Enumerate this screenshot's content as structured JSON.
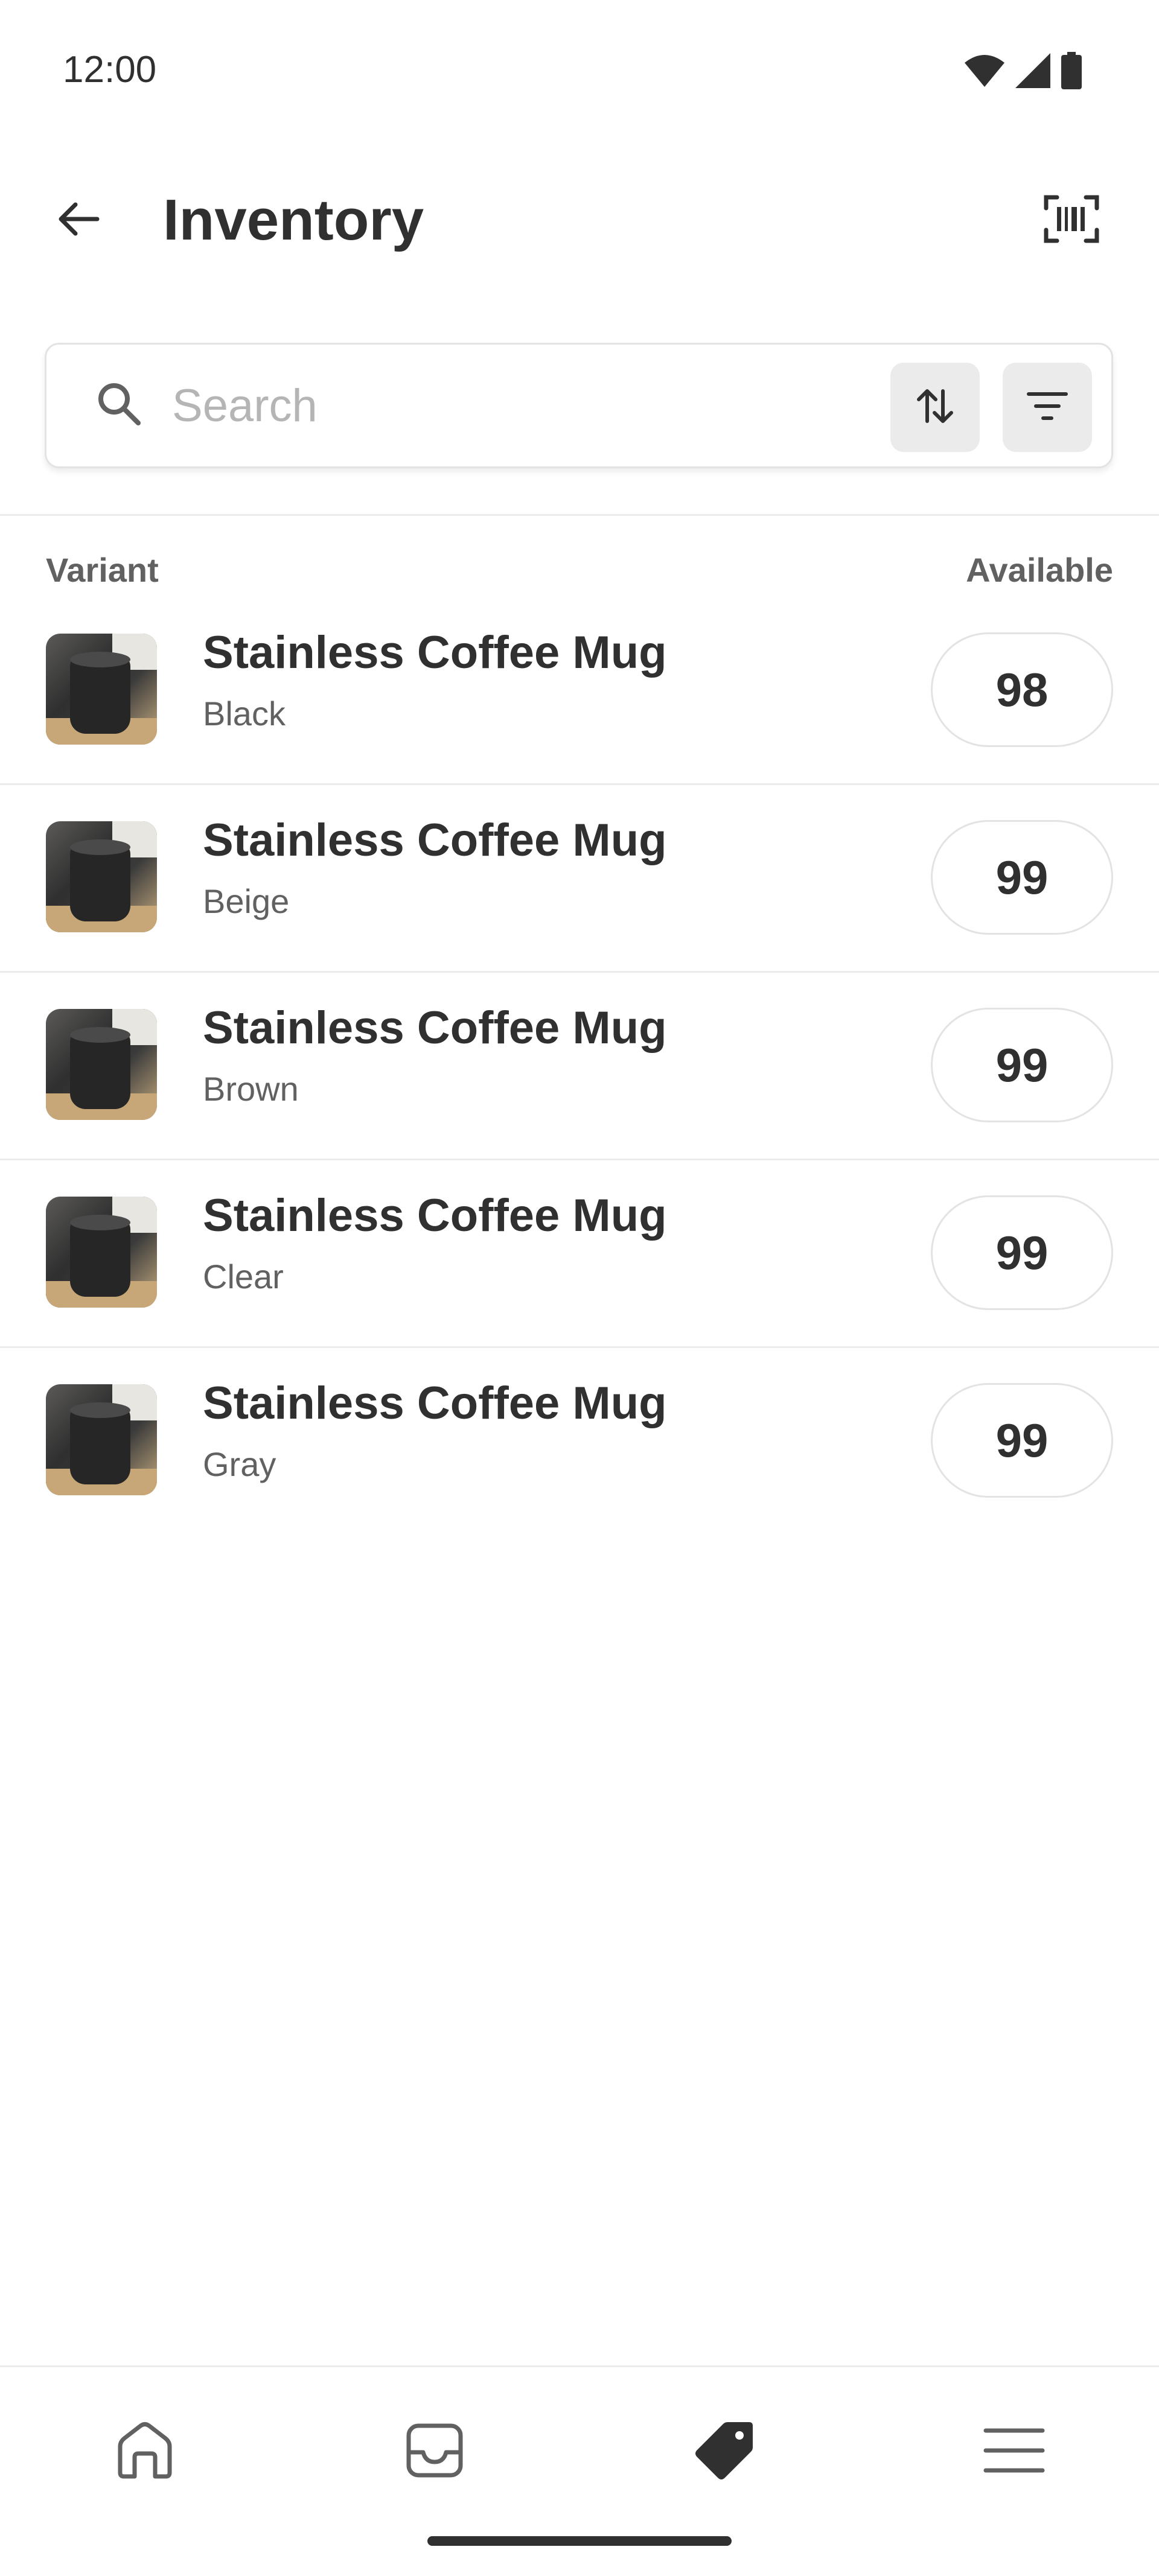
{
  "status_bar": {
    "time": "12:00",
    "icons": [
      "wifi-icon",
      "signal-icon",
      "battery-icon"
    ]
  },
  "header": {
    "title": "Inventory",
    "back_icon": "arrow-left-icon",
    "scan_icon": "barcode-scan-icon"
  },
  "search": {
    "placeholder": "Search",
    "value": "",
    "sort_icon": "sort-arrows-icon",
    "filter_icon": "filter-lines-icon"
  },
  "table": {
    "headers": {
      "variant": "Variant",
      "available": "Available"
    },
    "rows": [
      {
        "title": "Stainless Coffee Mug",
        "variant": "Black",
        "available": "98"
      },
      {
        "title": "Stainless Coffee Mug",
        "variant": "Beige",
        "available": "99"
      },
      {
        "title": "Stainless Coffee Mug",
        "variant": "Brown",
        "available": "99"
      },
      {
        "title": "Stainless Coffee Mug",
        "variant": "Clear",
        "available": "99"
      },
      {
        "title": "Stainless Coffee Mug",
        "variant": "Gray",
        "available": "99"
      }
    ]
  },
  "bottom_nav": {
    "items": [
      "home-icon",
      "inbox-icon",
      "tag-icon",
      "menu-icon"
    ],
    "active": "tag-icon"
  },
  "colors": {
    "text_primary": "#303030",
    "text_secondary": "#616161",
    "divider": "#ececec",
    "icon_button_bg": "#ebebeb",
    "placeholder": "#b5b5b5"
  }
}
